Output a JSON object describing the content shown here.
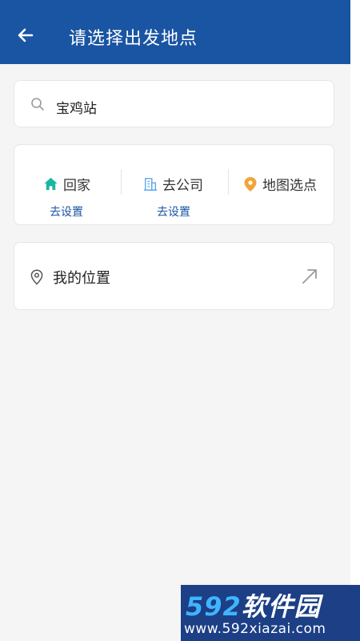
{
  "header": {
    "title": "请选择出发地点",
    "back_icon": "arrow-left-icon",
    "background": "#1a55a3"
  },
  "search": {
    "value": "宝鸡站",
    "icon": "search-icon"
  },
  "shortcuts": [
    {
      "label": "回家",
      "sub": "去设置",
      "icon": "home-icon",
      "icon_color": "#1bb5a3"
    },
    {
      "label": "去公司",
      "sub": "去设置",
      "icon": "office-building-icon",
      "icon_color": "#5aa7e6"
    },
    {
      "label": "地图选点",
      "sub": "",
      "icon": "map-pin-icon",
      "icon_color": "#f2a33a"
    }
  ],
  "location": {
    "label": "我的位置",
    "icon": "location-pin-icon",
    "action_icon": "arrow-up-right-icon"
  },
  "watermark": {
    "number": "592",
    "brand": "软件园",
    "url": "www.592xiazai.com"
  }
}
